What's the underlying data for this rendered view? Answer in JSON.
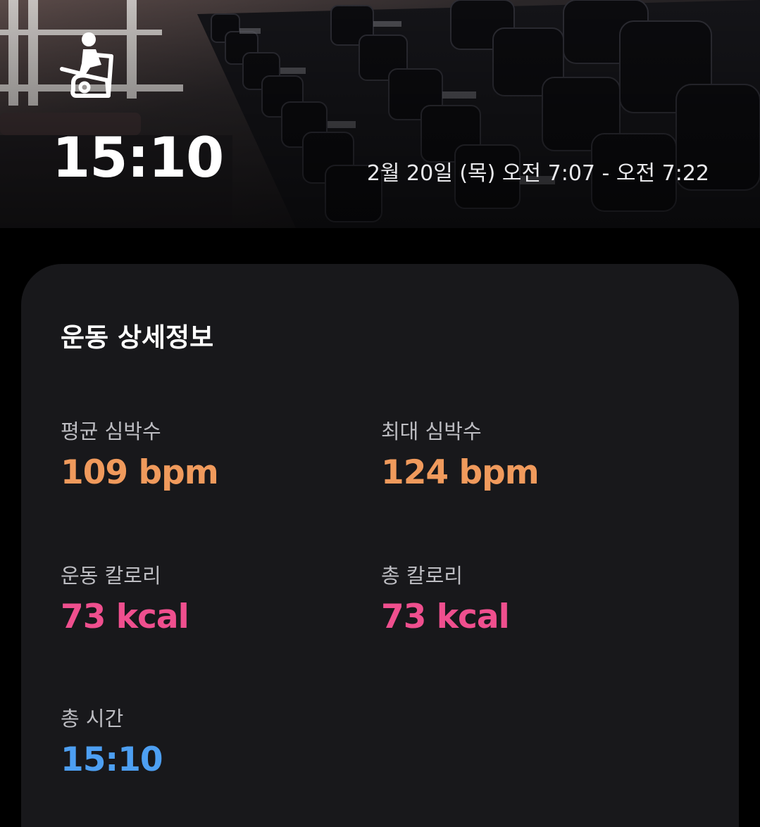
{
  "colors": {
    "heart_rate": "#f09a5c",
    "calories": "#ef4f8e",
    "time": "#4d9ff2",
    "card_background": "#18181b",
    "page_background": "#000000"
  },
  "header": {
    "image": "gym-dumbbell-rack-photo",
    "activity_icon": "stationary-bike-icon",
    "duration": "15:10",
    "date_range": "2월 20일 (목) 오전 7:07 - 오전 7:22"
  },
  "details": {
    "title": "운동 상세정보",
    "metrics": [
      {
        "label": "평균 심박수",
        "value": "109 bpm"
      },
      {
        "label": "최대 심박수",
        "value": "124 bpm"
      },
      {
        "label": "운동 칼로리",
        "value": "73 kcal"
      },
      {
        "label": "총 칼로리",
        "value": "73 kcal"
      },
      {
        "label": "총 시간",
        "value": "15:10"
      }
    ]
  }
}
